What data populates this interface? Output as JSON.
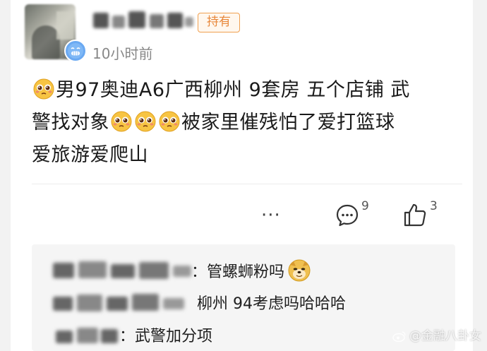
{
  "header": {
    "tag": "持有",
    "time": "10小时前"
  },
  "post": {
    "line1": "男97奥迪A6广西柳州 9套房 五个店铺 武",
    "line2a": "警找对象",
    "line2b": "被家里催残怕了爱打篮球",
    "line3": "爱旅游爱爬山"
  },
  "actions": {
    "more": "···",
    "comment_count": "9",
    "like_count": "3"
  },
  "comments": [
    {
      "text": "：管螺蛳粉吗"
    },
    {
      "text": "柳州 94考虑吗哈哈哈"
    },
    {
      "text": "：武警加分项"
    }
  ],
  "watermark": "@金融八卦女",
  "colors": {
    "tag_border": "#f0a050",
    "tag_text": "#e8873a",
    "badge_blue": "#6aa9f2"
  }
}
